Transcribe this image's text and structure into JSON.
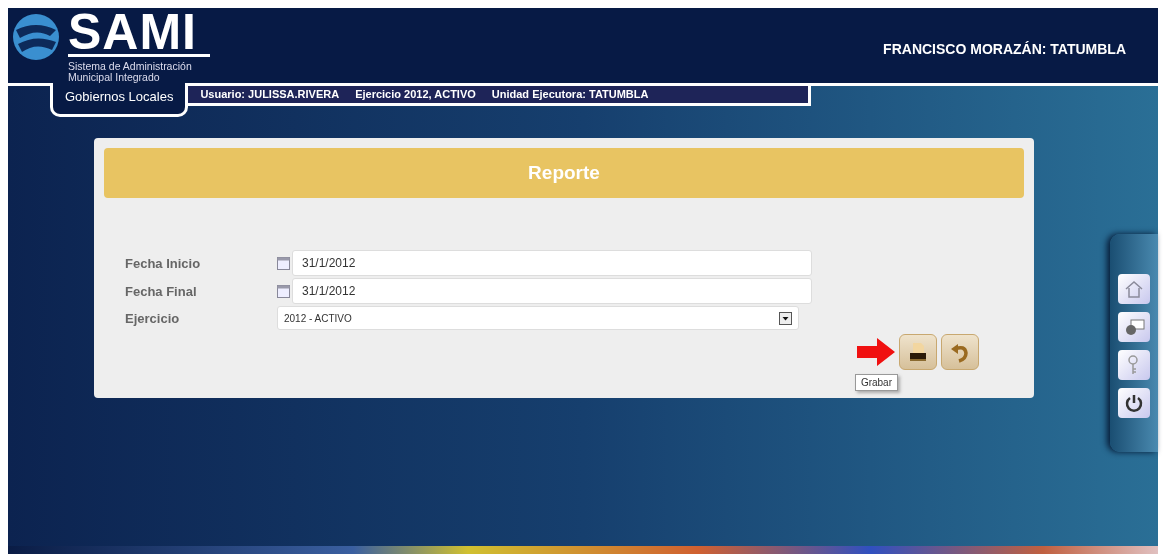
{
  "header": {
    "logo_text": "SAMI",
    "subtitle_line1": "Sistema de Administración",
    "subtitle_line2": "Municipal Integrado",
    "location": "FRANCISCO MORAZÁN: TATUMBLA"
  },
  "tab": {
    "label": "Gobiernos Locales",
    "selected": true
  },
  "info_bar": [
    "Usuario: JULISSA.RIVERA",
    "Ejercicio 2012, ACTIVO",
    "Unidad Ejecutora: TATUMBLA"
  ],
  "form": {
    "title": "Reporte",
    "fields": [
      {
        "kind": "date",
        "label": "Fecha Inicio",
        "value": "31/1/2012"
      },
      {
        "kind": "date",
        "label": "Fecha Final",
        "value": "31/1/2012"
      },
      {
        "kind": "select",
        "label": "Ejercicio",
        "value": "2012 - ACTIVO"
      }
    ],
    "tooltip": "Grabar"
  }
}
